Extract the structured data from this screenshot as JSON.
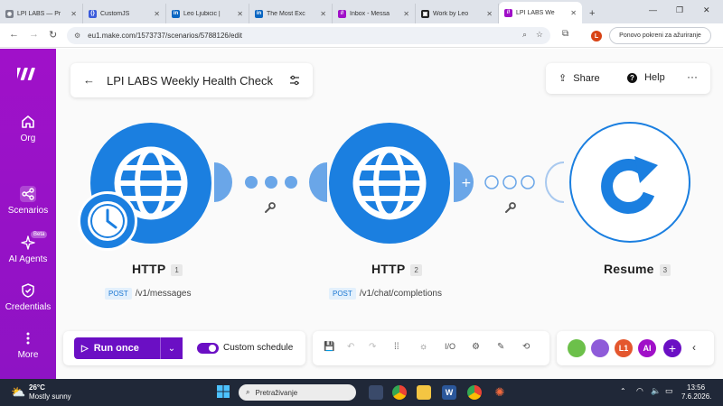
{
  "browser": {
    "tabs": [
      {
        "title": "LPI LABS — Pr",
        "fav_color": "#7a7f8a",
        "fav_glyph": "◉"
      },
      {
        "title": "CustomJS",
        "fav_color": "#3b5bdb",
        "fav_glyph": "{}"
      },
      {
        "title": "Leo Ljubicic |",
        "fav_color": "#0a66c2",
        "fav_glyph": "in"
      },
      {
        "title": "The Most Exc",
        "fav_color": "#0a66c2",
        "fav_glyph": "in"
      },
      {
        "title": "Inbox - Messa",
        "fav_color": "#a010c8",
        "fav_glyph": "//"
      },
      {
        "title": "Work by Leo",
        "fav_color": "#222222",
        "fav_glyph": "▣"
      },
      {
        "title": "LPI LABS We",
        "fav_color": "#a010c8",
        "fav_glyph": "//"
      }
    ],
    "new_tab": "+",
    "url": "eu1.make.com/1573737/scenarios/5788126/edit",
    "update_label": "Ponovo pokreni za ažuriranje",
    "profile_initial": "L"
  },
  "sidebar": {
    "items": [
      {
        "label": "Org",
        "icon": "home-icon"
      },
      {
        "label": "Scenarios",
        "icon": "scenarios-icon"
      },
      {
        "label": "AI Agents",
        "icon": "ai-agents-icon",
        "tag": "Beta"
      },
      {
        "label": "Credentials",
        "icon": "shield-icon"
      },
      {
        "label": "More",
        "icon": "more-vertical-icon"
      }
    ]
  },
  "header": {
    "title": "LPI LABS Weekly Health Check",
    "share_label": "Share",
    "help_label": "Help",
    "more_label": "···"
  },
  "modules": [
    {
      "name": "HTTP",
      "number": "1",
      "method": "POST",
      "path": "/v1/messages"
    },
    {
      "name": "HTTP",
      "number": "2",
      "method": "POST",
      "path": "/v1/chat/completions"
    },
    {
      "name": "Resume",
      "number": "3"
    }
  ],
  "toolbar": {
    "run_label": "Run once",
    "schedule_label": "Custom schedule",
    "avatars": [
      {
        "label": "",
        "color": "#6cc04a"
      },
      {
        "label": "",
        "color": "#8e5bd9"
      },
      {
        "label": "L1",
        "color": "#e4572e"
      },
      {
        "label": "AI",
        "color": "#a010c8"
      }
    ]
  },
  "taskbar": {
    "temperature": "26°C",
    "weather": "Mostly sunny",
    "search_placeholder": "Pretraživanje",
    "time": "13:56",
    "date": "7.6.2026."
  },
  "colors": {
    "accent": "#6b0fc4",
    "sidebar": "#a011c9",
    "http_blue": "#1b7fe0"
  }
}
